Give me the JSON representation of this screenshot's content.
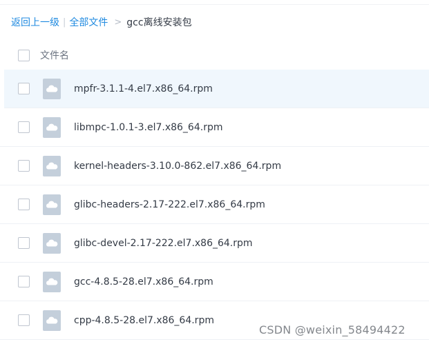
{
  "breadcrumb": {
    "back": "返回上一级",
    "separator": "|",
    "all_files": "全部文件",
    "arrow": ">",
    "current": "gcc离线安装包"
  },
  "header": {
    "column_name": "文件名"
  },
  "files": [
    {
      "name": "mpfr-3.1.1-4.el7.x86_64.rpm",
      "icon": "rpm-file-icon",
      "highlighted": true
    },
    {
      "name": "libmpc-1.0.1-3.el7.x86_64.rpm",
      "icon": "rpm-file-icon",
      "highlighted": false
    },
    {
      "name": "kernel-headers-3.10.0-862.el7.x86_64.rpm",
      "icon": "rpm-file-icon",
      "highlighted": false
    },
    {
      "name": "glibc-headers-2.17-222.el7.x86_64.rpm",
      "icon": "rpm-file-icon",
      "highlighted": false
    },
    {
      "name": "glibc-devel-2.17-222.el7.x86_64.rpm",
      "icon": "rpm-file-icon",
      "highlighted": false
    },
    {
      "name": "gcc-4.8.5-28.el7.x86_64.rpm",
      "icon": "rpm-file-icon",
      "highlighted": false
    },
    {
      "name": "cpp-4.8.5-28.el7.x86_64.rpm",
      "icon": "rpm-file-icon",
      "highlighted": false
    }
  ],
  "watermark": "CSDN @weixin_58494422",
  "colors": {
    "link": "#1f8ae0",
    "text": "#333a45",
    "highlight_row": "#f0f7fd",
    "icon_fill": "#c4cfdb"
  }
}
